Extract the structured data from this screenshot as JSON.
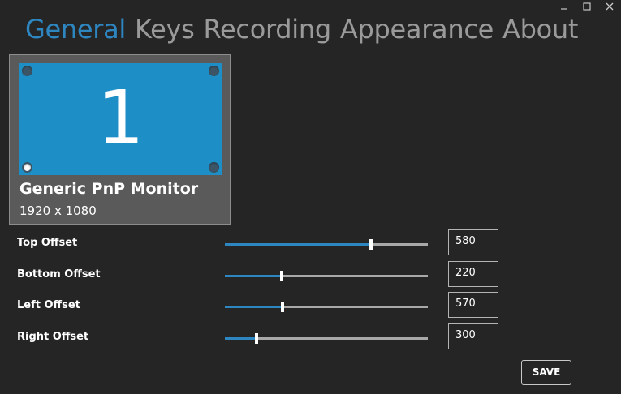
{
  "window_controls": {
    "minimize_icon": "minimize-icon",
    "maximize_icon": "maximize-icon",
    "close_icon": "close-icon"
  },
  "tabs": [
    {
      "label": "General",
      "active": true
    },
    {
      "label": "Keys",
      "active": false
    },
    {
      "label": "Recording",
      "active": false
    },
    {
      "label": "Appearance",
      "active": false
    },
    {
      "label": "About",
      "active": false
    }
  ],
  "monitor": {
    "number": "1",
    "name": "Generic PnP Monitor",
    "resolution": "1920 x 1080",
    "selected_corner": "bottom-left"
  },
  "offsets": [
    {
      "label": "Top Offset",
      "value": "580",
      "slider_fraction": 0.72
    },
    {
      "label": "Bottom Offset",
      "value": "220",
      "slider_fraction": 0.28
    },
    {
      "label": "Left Offset",
      "value": "570",
      "slider_fraction": 0.285
    },
    {
      "label": "Right Offset",
      "value": "300",
      "slider_fraction": 0.155
    }
  ],
  "save_label": "SAVE",
  "colors": {
    "accent": "#2e86c1",
    "background": "#252526",
    "monitor_screen": "#1e8fc6"
  }
}
